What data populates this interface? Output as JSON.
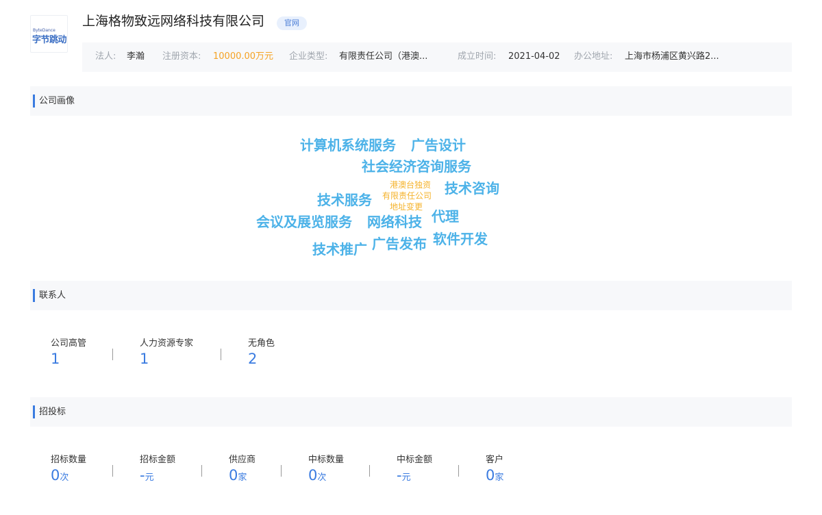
{
  "logo": {
    "small_text": "ByteDance",
    "big_text": "字节跳动"
  },
  "company": {
    "name": "上海格物致远网络科技有限公司",
    "badge": "官网"
  },
  "info": {
    "legal_label": "法人:",
    "legal_value": "李瀚",
    "capital_label": "注册资本:",
    "capital_value": "10000.00万元",
    "type_label": "企业类型:",
    "type_value": "有限责任公司（港澳...",
    "founded_label": "成立时间:",
    "founded_value": "2021-04-02",
    "address_label": "办公地址:",
    "address_value": "上海市杨浦区黄兴路2..."
  },
  "sections": {
    "portrait": "公司画像",
    "contacts": "联系人",
    "bidding": "招投标"
  },
  "word_cloud": [
    "计算机系统服务",
    "广告设计",
    "社会经济咨询服务",
    "港澳台独资",
    "有限责任公司",
    "地址变更",
    "技术服务",
    "技术咨询",
    "会议及展览服务",
    "网络科技",
    "代理",
    "技术推广",
    "广告发布",
    "软件开发"
  ],
  "contacts": [
    {
      "label": "公司高管",
      "value": "1"
    },
    {
      "label": "人力资源专家",
      "value": "1"
    },
    {
      "label": "无角色",
      "value": "2"
    }
  ],
  "bidding": [
    {
      "label": "招标数量",
      "value": "0",
      "unit": "次"
    },
    {
      "label": "招标金额",
      "value": "-",
      "unit": "元"
    },
    {
      "label": "供应商",
      "value": "0",
      "unit": "家"
    },
    {
      "label": "中标数量",
      "value": "0",
      "unit": "次"
    },
    {
      "label": "中标金额",
      "value": "-",
      "unit": "元"
    },
    {
      "label": "客户",
      "value": "0",
      "unit": "家"
    }
  ],
  "colors": {
    "accent": "#3a7be0",
    "cloud_blue": "#4cb2e8",
    "cloud_orange": "#f5b32c",
    "capital_orange": "#f5a223"
  }
}
